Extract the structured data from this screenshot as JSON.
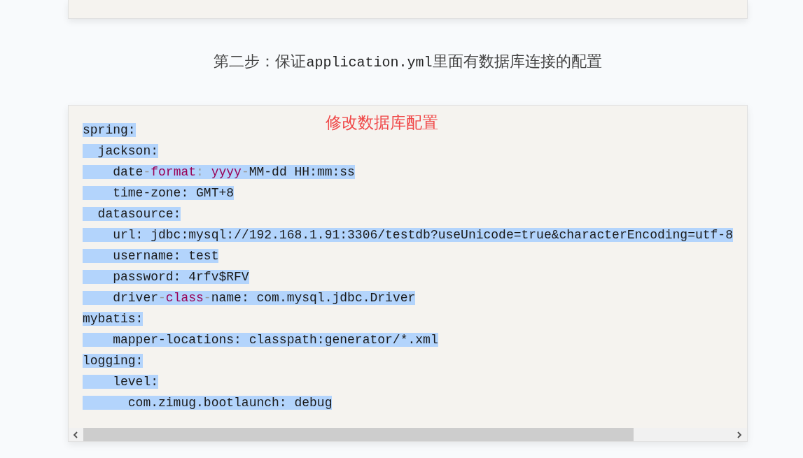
{
  "heading": {
    "segments": [
      {
        "kind": "text",
        "text": "第二步：保证"
      },
      {
        "kind": "code",
        "text": "application.yml"
      },
      {
        "kind": "text",
        "text": "里面有数据库连接的配置"
      }
    ]
  },
  "code_block": {
    "annotation": "修改数据库配置",
    "lines": [
      {
        "selected": true,
        "tokens": [
          {
            "kind": "plain",
            "text": "spring:"
          }
        ]
      },
      {
        "selected": true,
        "tokens": [
          {
            "kind": "plain",
            "text": "  jackson:"
          }
        ]
      },
      {
        "selected": true,
        "tokens": [
          {
            "kind": "plain",
            "text": "    date"
          },
          {
            "kind": "punct",
            "text": "-"
          },
          {
            "kind": "keyword",
            "text": "format"
          },
          {
            "kind": "punct",
            "text": ":"
          },
          {
            "kind": "keyword",
            "text": " yyyy"
          },
          {
            "kind": "punct",
            "text": "-"
          },
          {
            "kind": "plain",
            "text": "MM-dd HH:mm:ss"
          }
        ]
      },
      {
        "selected": true,
        "tokens": [
          {
            "kind": "plain",
            "text": "    time-zone: GMT+8"
          }
        ]
      },
      {
        "selected": true,
        "tokens": [
          {
            "kind": "plain",
            "text": "  datasource:"
          }
        ]
      },
      {
        "selected": true,
        "tokens": [
          {
            "kind": "plain",
            "text": "    url: jdbc:mysql://192.168.1.91:3306/testdb?useUnicode=true&characterEncoding=utf-8"
          }
        ]
      },
      {
        "selected": true,
        "tokens": [
          {
            "kind": "plain",
            "text": "    username: test"
          }
        ]
      },
      {
        "selected": true,
        "tokens": [
          {
            "kind": "plain",
            "text": "    password: 4rfv$RFV"
          }
        ]
      },
      {
        "selected": true,
        "tokens": [
          {
            "kind": "plain",
            "text": "    driver"
          },
          {
            "kind": "punct",
            "text": "-"
          },
          {
            "kind": "keyword",
            "text": "class"
          },
          {
            "kind": "punct",
            "text": "-"
          },
          {
            "kind": "plain",
            "text": "name: com.mysql.jdbc.Driver"
          }
        ]
      },
      {
        "selected": true,
        "tokens": [
          {
            "kind": "plain",
            "text": "mybatis:"
          }
        ]
      },
      {
        "selected": true,
        "tokens": [
          {
            "kind": "plain",
            "text": "    mapper-locations: classpath:generator/*.xml"
          }
        ]
      },
      {
        "selected": true,
        "tokens": [
          {
            "kind": "plain",
            "text": "logging:"
          }
        ]
      },
      {
        "selected": true,
        "tokens": [
          {
            "kind": "plain",
            "text": "    level:"
          }
        ]
      },
      {
        "selected": true,
        "tokens": [
          {
            "kind": "plain",
            "text": "      com.zimug.bootlaunch: debug"
          }
        ]
      }
    ]
  }
}
